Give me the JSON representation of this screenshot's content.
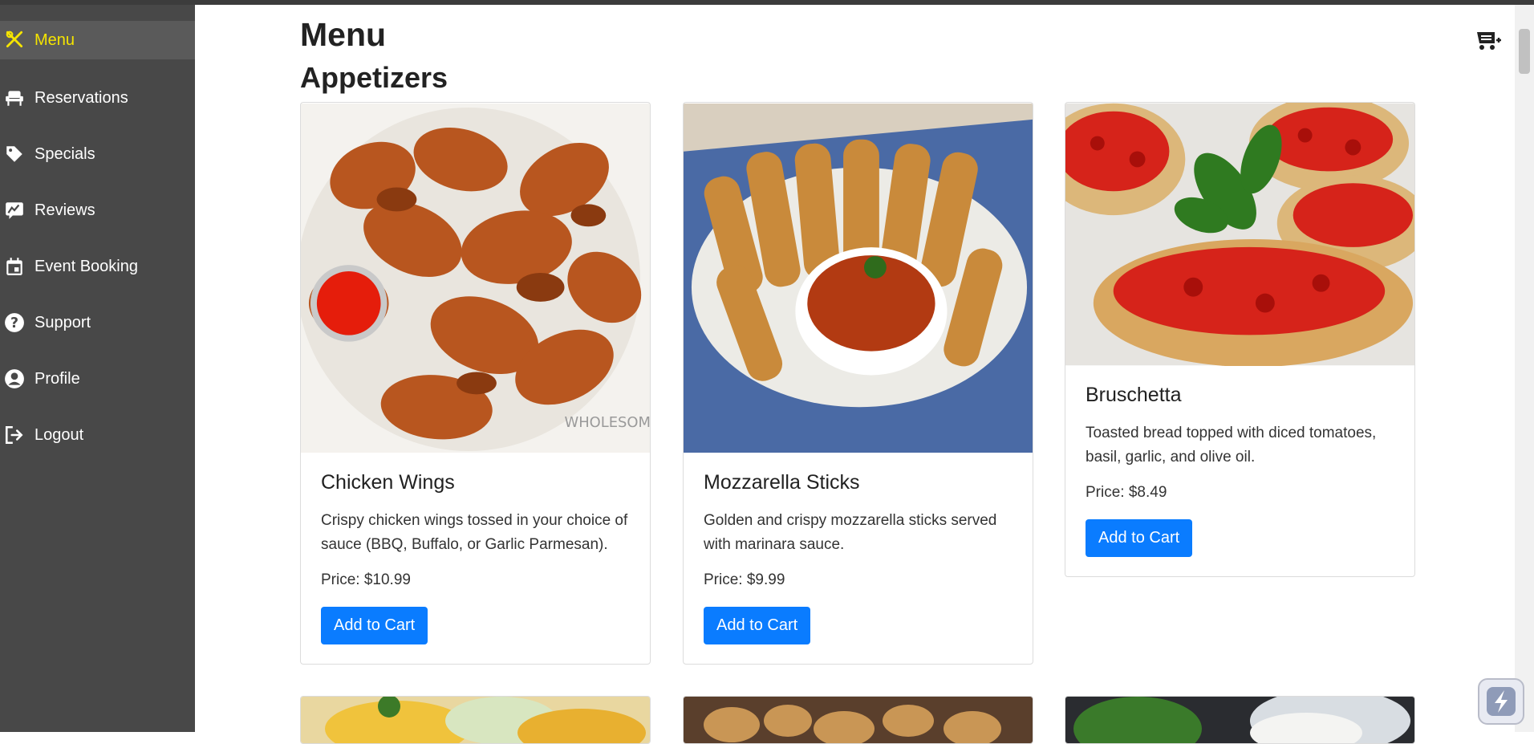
{
  "sidebar": {
    "items": [
      {
        "label": "Menu",
        "icon": "utensils-icon",
        "active": true
      },
      {
        "label": "Reservations",
        "icon": "chair-icon"
      },
      {
        "label": "Specials",
        "icon": "tag-icon"
      },
      {
        "label": "Reviews",
        "icon": "review-icon"
      },
      {
        "label": "Event Booking",
        "icon": "calendar-icon"
      },
      {
        "label": "Support",
        "icon": "question-icon"
      },
      {
        "label": "Profile",
        "icon": "user-circle-icon"
      },
      {
        "label": "Logout",
        "icon": "logout-icon"
      }
    ]
  },
  "main": {
    "title": "Menu",
    "section": "Appetizers",
    "cards": [
      {
        "name": "Chicken Wings",
        "description": "Crispy chicken wings tossed in your choice of sauce (BBQ, Buffalo, or Garlic Parmesan).",
        "price": "Price: $10.99",
        "button": "Add to Cart"
      },
      {
        "name": "Mozzarella Sticks",
        "description": "Golden and crispy mozzarella sticks served with marinara sauce.",
        "price": "Price: $9.99",
        "button": "Add to Cart"
      },
      {
        "name": "Bruschetta",
        "description": "Toasted bread topped with diced tomatoes, basil, garlic, and olive oil.",
        "price": "Price: $8.49",
        "button": "Add to Cart"
      }
    ]
  },
  "colors": {
    "sidebar_bg": "#484848",
    "active_accent": "#f5e400",
    "button": "#0a7cff"
  }
}
